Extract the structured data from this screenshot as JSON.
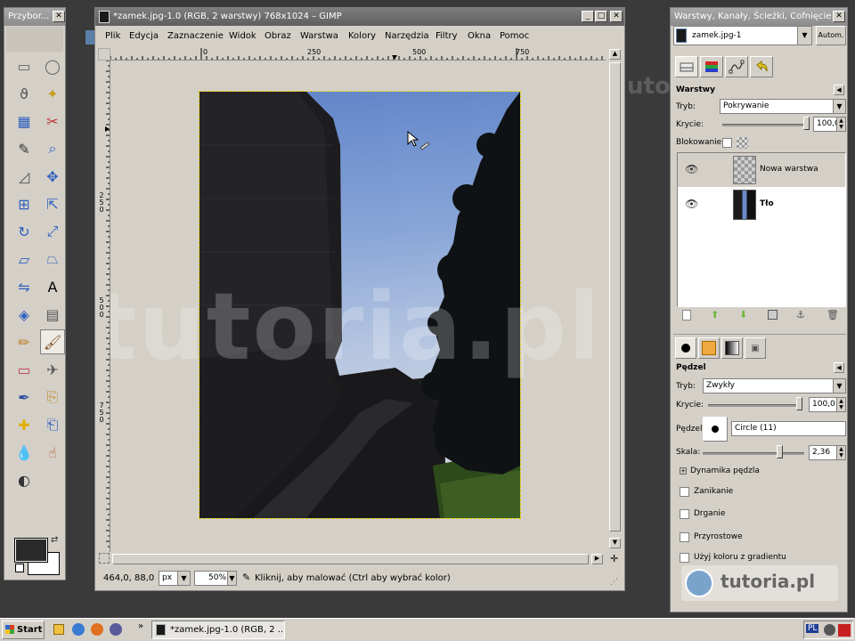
{
  "toolbox": {
    "title": "Przybor...",
    "tools": [
      "rect-select-icon",
      "ellipse-select-icon",
      "lasso-icon",
      "magic-wand-icon",
      "select-by-color-icon",
      "scissors-icon",
      "color-picker-icon",
      "zoom-icon",
      "measure-icon",
      "move-icon",
      "align-icon",
      "transform-icon",
      "rotate-icon",
      "scale-icon",
      "shear-icon",
      "perspective-icon",
      "flip-icon",
      "text-icon",
      "bucket-fill-icon",
      "blend-icon",
      "pencil-icon",
      "paintbrush-icon",
      "eraser-icon",
      "airbrush-icon",
      "ink-icon",
      "clone-icon",
      "heal-icon",
      "perspective-clone-icon",
      "blur-icon",
      "smudge-icon",
      "dodge-icon"
    ],
    "fg_color": "#2a2a2a",
    "bg_color": "#ffffff"
  },
  "image_window": {
    "title": "*zamek.jpg-1.0 (RGB, 2 warstwy) 768x1024 – GIMP",
    "menu": [
      "Plik",
      "Edycja",
      "Zaznaczenie",
      "Widok",
      "Obraz",
      "Warstwa",
      "Kolory",
      "Narzędzia",
      "Filtry",
      "Okna",
      "Pomoc"
    ],
    "ruler_h": [
      "0",
      "250",
      "500",
      "750"
    ],
    "ruler_v": [
      "250",
      "500",
      "750"
    ],
    "status": {
      "coords": "464,0, 88,0",
      "unit": "px",
      "zoom": "50%",
      "message": "Kliknij, aby malować (Ctrl aby wybrać kolor)"
    },
    "watermark": "tutoria.pl"
  },
  "layers_dialog": {
    "title": "Warstwy, Kanały, Ścieżki, Cofnięcie",
    "image_select": "zamek.jpg-1",
    "auto_button": "Autom.",
    "section_title": "Warstwy",
    "mode_label": "Tryb:",
    "mode_value": "Pokrywanie",
    "opacity_label": "Krycie:",
    "opacity_value": "100,0",
    "lock_label": "Blokowanie:",
    "layers": [
      {
        "name": "Nowa warstwa",
        "selected": false
      },
      {
        "name": "Tło",
        "selected": true
      }
    ]
  },
  "brush_options": {
    "section_title": "Pędzel",
    "mode_label": "Tryb:",
    "mode_value": "Zwykły",
    "opacity_label": "Krycie:",
    "opacity_value": "100,0",
    "brush_label": "Pędzel:",
    "brush_value": "Circle (11)",
    "scale_label": "Skala:",
    "scale_value": "2,36",
    "dynamics_label": "Dynamika pędzla",
    "fade_label": "Zanikanie",
    "jitter_label": "Drganie",
    "incremental_label": "Przyrostowe",
    "gradient_label": "Użyj koloru z gradientu",
    "logo_text": "tutoria.pl"
  },
  "taskbar": {
    "start_label": "Start",
    "task_label": "*zamek.jpg-1.0 (RGB, 2 ...",
    "lang": "PL"
  }
}
